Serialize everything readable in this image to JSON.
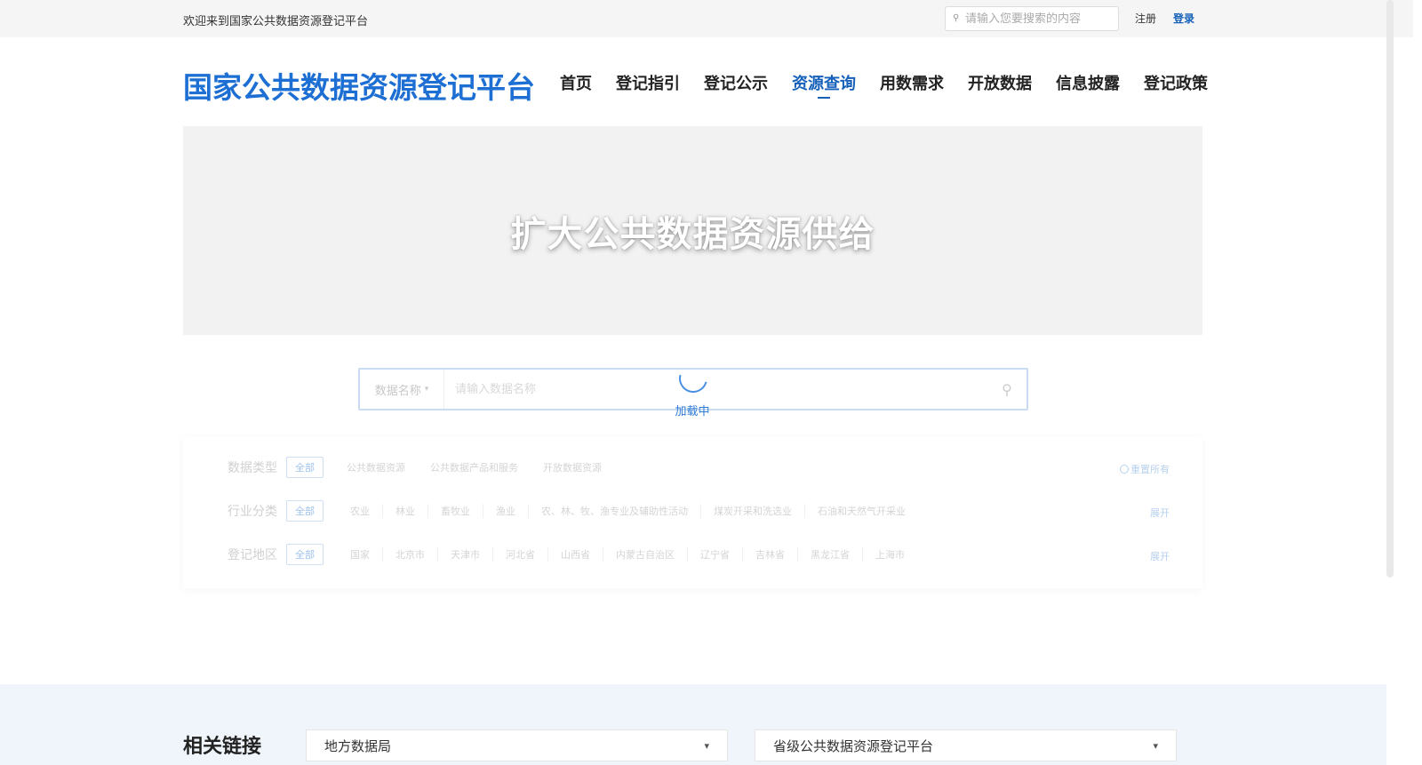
{
  "topbar": {
    "welcome": "欢迎来到国家公共数据资源登记平台",
    "search_placeholder": "请输入您要搜索的内容",
    "register": "注册",
    "login": "登录"
  },
  "header": {
    "logo": "国家公共数据资源登记平台",
    "nav": [
      "首页",
      "登记指引",
      "登记公示",
      "资源查询",
      "用数需求",
      "开放数据",
      "信息披露",
      "登记政策"
    ],
    "active_nav": "资源查询"
  },
  "banner": {
    "title": "扩大公共数据资源供给"
  },
  "search": {
    "type_label": "数据名称",
    "placeholder": "请输入数据名称"
  },
  "loading": {
    "text": "加载中"
  },
  "filters": {
    "rows": [
      {
        "label": "数据类型",
        "all": "全部",
        "options": [
          "公共数据资源",
          "公共数据产品和服务",
          "开放数据资源"
        ],
        "side": "重置所有"
      },
      {
        "label": "行业分类",
        "all": "全部",
        "options": [
          "农业",
          "林业",
          "畜牧业",
          "渔业",
          "农、林、牧、渔专业及辅助性活动",
          "煤炭开采和洗选业",
          "石油和天然气开采业"
        ],
        "side": "展开"
      },
      {
        "label": "登记地区",
        "all": "全部",
        "options": [
          "国家",
          "北京市",
          "天津市",
          "河北省",
          "山西省",
          "内蒙古自治区",
          "辽宁省",
          "吉林省",
          "黑龙江省",
          "上海市"
        ],
        "side": "展开"
      }
    ]
  },
  "footer": {
    "related_title": "相关链接",
    "select1": "地方数据局",
    "select2": "省级公共数据资源登记平台"
  },
  "colors": {
    "brand": "#1d6fd4",
    "nav_active": "#1560b8",
    "footer_bg": "#f0f5fb"
  },
  "icons": {
    "search": "search-icon",
    "dropdown": "chevron-down-icon",
    "reset": "refresh-icon",
    "spinner": "loading-spinner"
  }
}
